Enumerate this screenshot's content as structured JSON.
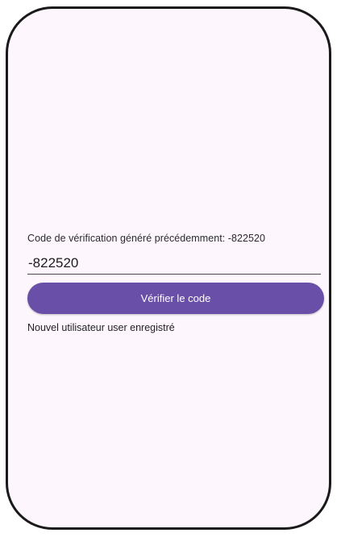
{
  "verification": {
    "previous_code_label": "Code de vérification généré précédemment: -822520",
    "code_value": "-822520",
    "verify_button_label": "Vérifier le code",
    "status_message": "Nouvel utilisateur user enregistré"
  },
  "colors": {
    "background": "#fdf7fd",
    "button": "#6a4fa8",
    "frame": "#1a1a1a"
  }
}
